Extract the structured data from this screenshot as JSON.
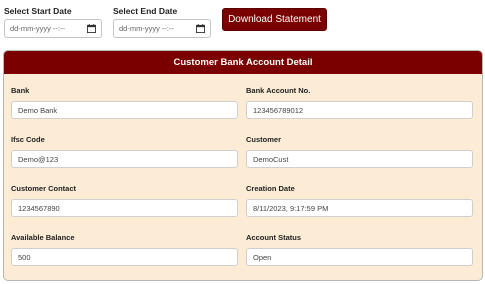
{
  "filters": {
    "start": {
      "label": "Select Start Date",
      "placeholder": "dd-mm-yyyy --:--"
    },
    "end": {
      "label": "Select End Date",
      "placeholder": "dd-mm-yyyy --:--"
    },
    "download_label": "Download Statement"
  },
  "card": {
    "title": "Customer Bank Account Detail",
    "fields": {
      "bank": {
        "label": "Bank",
        "value": "Demo Bank"
      },
      "account_no": {
        "label": "Bank Account No.",
        "value": "123456789012"
      },
      "ifsc": {
        "label": "Ifsc Code",
        "value": "Demo@123"
      },
      "customer": {
        "label": "Customer",
        "value": "DemoCust"
      },
      "contact": {
        "label": "Customer Contact",
        "value": "1234567890"
      },
      "creation_date": {
        "label": "Creation Date",
        "value": "8/11/2023, 9:17:59 PM"
      },
      "balance": {
        "label": "Available Balance",
        "value": "500"
      },
      "status": {
        "label": "Account Status",
        "value": "Open"
      }
    }
  },
  "colors": {
    "header_bg": "#7a0000",
    "card_bg": "#fcecd6",
    "button_bg": "#7a0000"
  }
}
